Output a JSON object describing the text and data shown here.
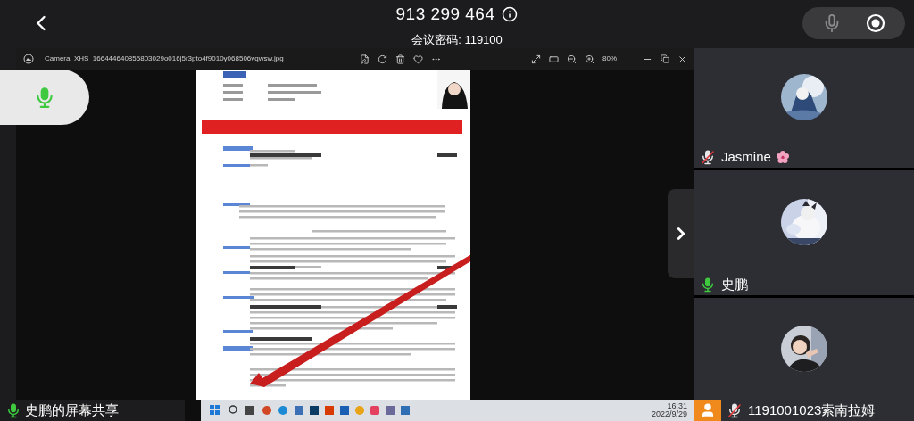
{
  "meeting": {
    "number": "913 299 464",
    "password": "会议密码: 119100"
  },
  "self_mic": {
    "muted": false
  },
  "shared_screen": {
    "sharer_label": "史鹏的屏幕共享",
    "viewer": {
      "file_name": "Camera_XHS_166444640855803029o016j5r3pto4f9010y068506vqwsw.jpg",
      "zoom": "80%"
    },
    "taskbar": {
      "time": "16:31",
      "date": "2022/9/29"
    }
  },
  "participants": [
    {
      "name": "Jasmine",
      "muted": true,
      "is_self": false
    },
    {
      "name": "史鹏",
      "muted": false,
      "is_self": false
    },
    {
      "name": "1191001023索南拉姆",
      "muted": true,
      "is_self": true
    }
  ]
}
